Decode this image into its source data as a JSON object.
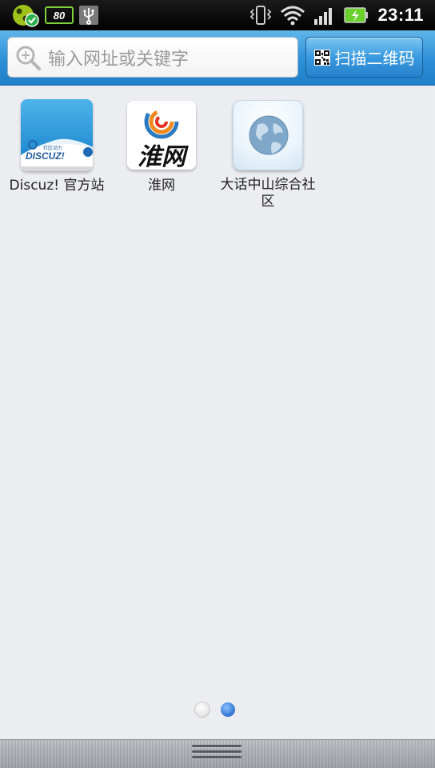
{
  "status_bar": {
    "battery_badge_text": "80",
    "clock": "23:11"
  },
  "search": {
    "placeholder": "输入网址或关键字",
    "scan_label": "扫描二维码"
  },
  "shortcuts": [
    {
      "label": "Discuz! 官方站",
      "icon": "discuz-logo-icon"
    },
    {
      "label": "淮网",
      "icon": "huaiwang-logo-icon"
    },
    {
      "label": "大话中山综合社区",
      "icon": "globe-icon"
    }
  ],
  "tiles": {
    "discuz_logo_text": "DISCUZ!",
    "discuz_sub_text": "社区动力",
    "huaiwang_logo_text": "淮网"
  },
  "pager": {
    "count": 2,
    "active": 1
  },
  "colors": {
    "search_bar": "#2d8fd6",
    "scan_button": "#3a9ae0",
    "pager_active": "#3a7fd8",
    "background": "#eceef2"
  }
}
